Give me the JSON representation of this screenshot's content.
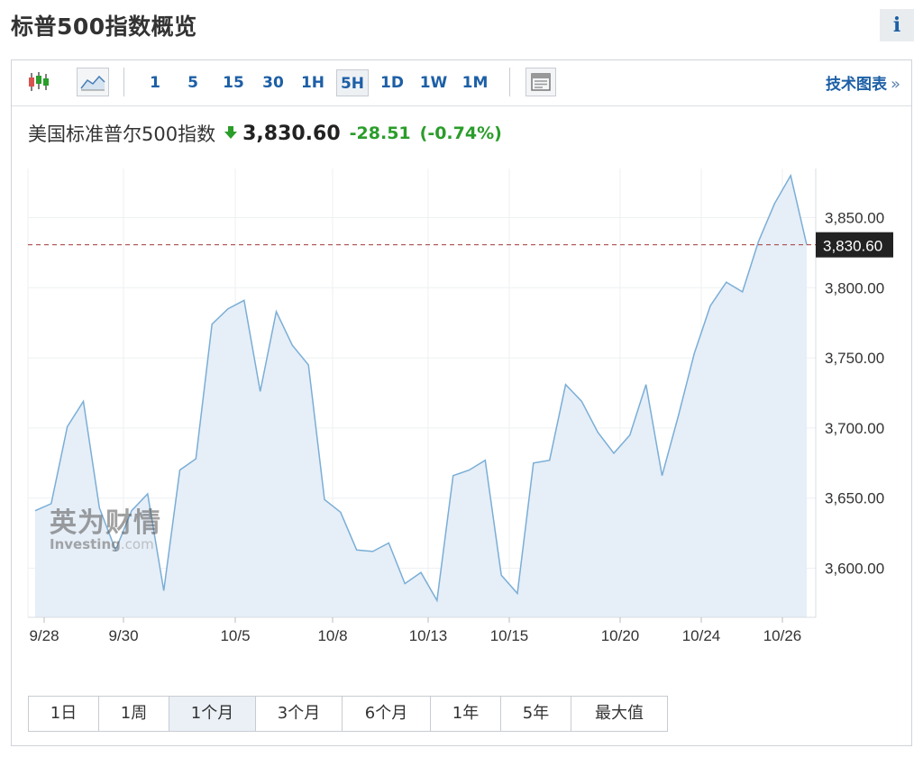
{
  "page": {
    "title": "标普500指数概览",
    "info_label": "i"
  },
  "toolbar": {
    "intervals": [
      "1",
      "5",
      "15",
      "30",
      "1H",
      "5H",
      "1D",
      "1W",
      "1M"
    ],
    "active_interval": "5H",
    "tech_chart_label": "技术图表",
    "tech_chart_arrow": "»"
  },
  "quote": {
    "name": "美国标准普尔500指数",
    "price": "3,830.60",
    "change": "-28.51",
    "change_pct": "(-0.74%)",
    "direction": "down",
    "change_color": "#2a9d2a"
  },
  "watermark": {
    "cn": "英为财情",
    "en_main": "Investing",
    "en_suffix": ".com"
  },
  "chart_data": {
    "type": "area",
    "title": "",
    "xlabel": "",
    "ylabel": "",
    "ylim": [
      3565,
      3885
    ],
    "yticks": [
      "3,600.00",
      "3,650.00",
      "3,700.00",
      "3,750.00",
      "3,800.00",
      "3,850.00"
    ],
    "xtick_labels": [
      "9/28",
      "9/30",
      "10/5",
      "10/8",
      "10/13",
      "10/15",
      "10/20",
      "10/24",
      "10/26"
    ],
    "current_value": 3830.6,
    "current_label": "3,830.60",
    "line_color": "#7aaed6",
    "fill_color": "#e6eef7",
    "ref_line_color": "#a33a3a",
    "grid": true,
    "series": [
      {
        "values": [
          3641,
          3646,
          3701,
          3719,
          3643,
          3613,
          3641,
          3653,
          3584,
          3670,
          3678,
          3774,
          3785,
          3791,
          3726,
          3783,
          3759,
          3745,
          3649,
          3640,
          3613,
          3612,
          3618,
          3589,
          3597,
          3577,
          3666,
          3670,
          3677,
          3595,
          3582,
          3675,
          3677,
          3731,
          3719,
          3697,
          3682,
          3695,
          3731,
          3666,
          3708,
          3753,
          3787,
          3804,
          3797,
          3833,
          3860,
          3880,
          3830.6
        ]
      }
    ]
  },
  "ranges": {
    "items": [
      "1日",
      "1周",
      "1个月",
      "3个月",
      "6个月",
      "1年",
      "5年",
      "最大值"
    ],
    "active": "1个月"
  }
}
